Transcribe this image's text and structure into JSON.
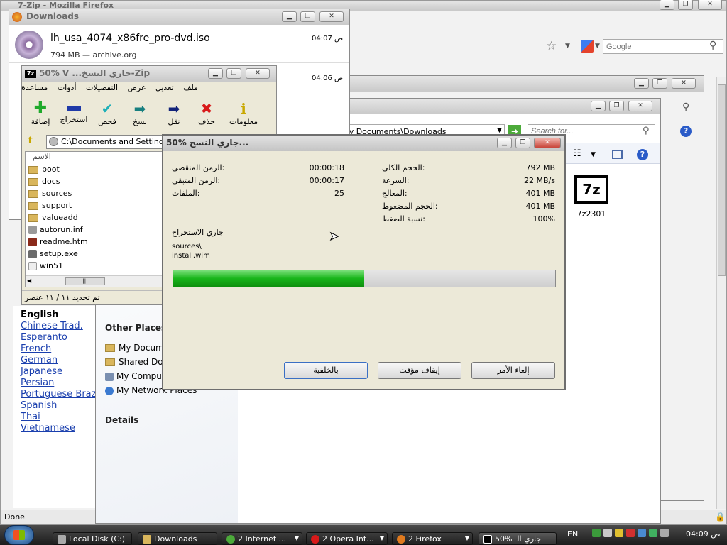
{
  "firefox": {
    "title": "7-Zip - Mozilla Firefox",
    "search_placeholder": "Google",
    "status": "Done"
  },
  "languages": [
    "English",
    "Chinese Trad.",
    "Esperanto",
    "French",
    "German",
    "Japanese",
    "Persian",
    "Portuguese Braz",
    "Spanish",
    "Thai",
    "Vietnamese"
  ],
  "downloads": {
    "title": "Downloads",
    "items": [
      {
        "name": "lh_usa_4074_x86fre_pro-dvd.iso",
        "meta": "794 MB — archive.org",
        "time": "ص 04:07"
      },
      {
        "name": "",
        "meta": "",
        "time": "ص 04:06"
      }
    ]
  },
  "sevenzip": {
    "title": "50% V ...جاري النسخ-Zip",
    "menu": [
      "ملف",
      "تعديل",
      "عرض",
      "التفضيلات",
      "أدوات",
      "مساعدة"
    ],
    "toolbar": [
      "إضافة",
      "استخراج",
      "فحص",
      "نسخ",
      "نقل",
      "حذف",
      "معلومات"
    ],
    "path": "C:\\Documents and Settings\\",
    "column": "الاسم",
    "files": [
      "boot",
      "docs",
      "sources",
      "support",
      "valueadd",
      "autorun.inf",
      "readme.htm",
      "setup.exe",
      "win51"
    ],
    "status": "تم تحديد ١١ / ١١ عنصر"
  },
  "explorer": {
    "path": "M8 Genius 2010\\My Documents\\Downloads",
    "search_placeholder": "Search for...",
    "file": "7z2301",
    "other_places_title": "Other Places",
    "other_places": [
      "My Documents",
      "Shared Documents",
      "My Computer",
      "My Network Places"
    ],
    "details_title": "Details"
  },
  "progress": {
    "title": "50% جاري النسخ...",
    "left_labels": [
      "الزمن المنقضي:",
      "الزمن المتبقي:",
      "الملفات:"
    ],
    "left_values": [
      "00:00:18",
      "00:00:17",
      "25"
    ],
    "right_labels": [
      "الحجم الكلي:",
      "السرعة:",
      "المعالج:",
      "الحجم المضغوط:",
      "نسبة الضغط:"
    ],
    "right_values": [
      "792 MB",
      "22 MB/s",
      "401 MB",
      "401 MB",
      "100%"
    ],
    "op_label": "جاري الاستخراج",
    "current_dir": "sources\\",
    "current_file": "install.wim",
    "percent": 0.5,
    "buttons": [
      "بالخلفية",
      "إيقاف مؤقت",
      "إلغاء الأمر"
    ]
  },
  "taskbar": {
    "items": [
      "Local Disk (C:)",
      "Downloads",
      "2 Internet ...",
      "2 Opera Int...",
      "2 Firefox",
      "50% جاري الـ"
    ],
    "lang": "EN",
    "clock": "ص 04:09"
  }
}
